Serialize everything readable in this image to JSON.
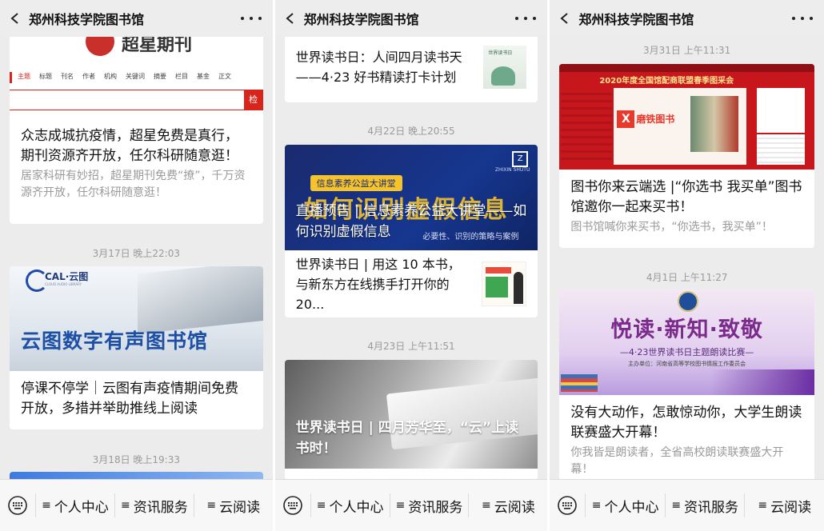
{
  "app": {
    "title": "郑州科技学院图书馆"
  },
  "bottom_bar": {
    "items": [
      "个人中心",
      "资讯服务",
      "云阅读"
    ]
  },
  "screen1": {
    "chaoxing_logo": "超星期刊",
    "chaoxing_tabs": [
      "主题",
      "标题",
      "刊名",
      "作者",
      "机构",
      "关键词",
      "摘要",
      "栏目",
      "基金",
      "正文"
    ],
    "chaoxing_search_btn": "检",
    "card1_title": "众志成城抗疫情，超星免费是真行，期刊资源齐开放，任尔科研随意逛！",
    "card1_desc": "居家科研有妙招，超星期刊免费“撩”，千万资源齐开放，任尔科研随意逛！",
    "time1": "3月17日 晚上22:03",
    "cal_logo": "CAL·云图",
    "cal_sub": "CLOUD AUDIO LIBRARY",
    "cal_banner": "云图数字有声图书馆",
    "card2_title": "停课不停学｜云图有声疫情期间免费开放，多措并举助推线上阅读",
    "time2": "3月18日 晚上19:33"
  },
  "screen2": {
    "row1_title": "世界读书日：人间四月读书天——4·23 好书精读打卡计划",
    "row1_thumb": "世界读书日",
    "time1": "4月22日 晚上20:55",
    "banner_tag": "信息素养公益大讲堂",
    "banner_big": "如何识别虚假信息",
    "banner_sub": "必要性、识别的策略与案例",
    "banner_brand": "ZHIXIN SHUTU",
    "card_title": "直播预告 | 信息素养公益大讲堂——如何识别虚假信息",
    "row2_title": "世界读书日 | 用这 10 本书，与新东方在线携手打开你的20...",
    "time2": "4月23日 上午11:51",
    "card3_title": "世界读书日 | 四月芳华至，“云”上读书时！"
  },
  "screen3": {
    "time1": "3月31日 上午11:31",
    "banner_head": "2020年度全国馆配商联盟春季图采会",
    "banner_brand": "磨铁图书",
    "card1_title": "图书你来云端选 |“你选书 我买单”图书馆邀你一起来买书！",
    "card1_desc": "图书馆喊你来买书，“你选书，我买单”！",
    "time2": "4月1日 上午11:27",
    "banner2_big": "悦读·新知·致敬",
    "banner2_sub": "—4·23世界读书日主题朗读比赛—",
    "banner2_org": "主办单位：河南省高等学校图书情报工作委员会",
    "card2_title": "没有大动作，怎敢惊动你，大学生朗读联赛盛大开幕！",
    "card2_desc": "你我皆是朗读者，全省高校朗读联赛盛大开幕！"
  },
  "colors": {
    "chaoxing_red": "#d9241b",
    "bar_bg": "#ededed",
    "page_bg": "#ececec",
    "gray_text": "#9a9a9a",
    "dark_blue": "#1a2a6e",
    "banner_yellow": "#f5c32c"
  },
  "icons": [
    "back-icon",
    "more-icon",
    "keyboard-icon",
    "menu-bars-icon"
  ]
}
